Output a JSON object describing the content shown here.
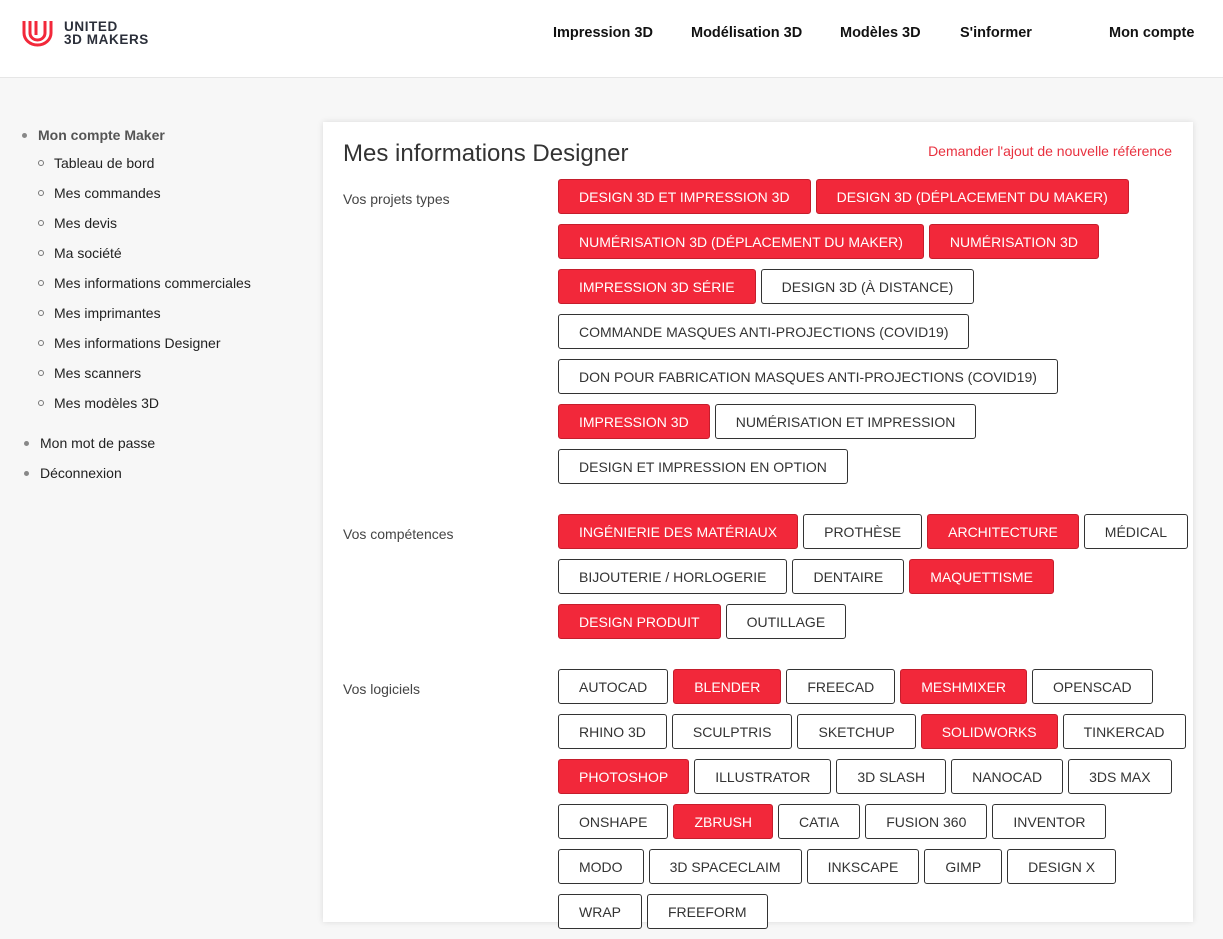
{
  "header": {
    "logo_line1": "UNITED",
    "logo_line2": "3D MAKERS",
    "nav": [
      {
        "label": "Impression 3D"
      },
      {
        "label": "Modélisation 3D"
      },
      {
        "label": "Modèles 3D"
      },
      {
        "label": "S'informer"
      },
      {
        "label": "Mon compte"
      }
    ]
  },
  "sidebar": {
    "heading": "Mon compte Maker",
    "subitems": [
      "Tableau de bord",
      "Mes commandes",
      "Mes devis",
      "Ma société",
      "Mes informations commerciales",
      "Mes imprimantes",
      "Mes informations Designer",
      "Mes scanners",
      "Mes modèles 3D"
    ],
    "items": [
      "Mon mot de passe",
      "Déconnexion"
    ]
  },
  "main": {
    "title": "Mes informations Designer",
    "request_link": "Demander l'ajout de nouvelle référence",
    "sections": [
      {
        "label": "Vos projets types",
        "rows": [
          [
            {
              "label": "DESIGN 3D ET IMPRESSION 3D",
              "selected": true
            },
            {
              "label": "DESIGN 3D (DÉPLACEMENT DU MAKER)",
              "selected": true
            }
          ],
          [
            {
              "label": "NUMÉRISATION 3D (DÉPLACEMENT DU MAKER)",
              "selected": true
            },
            {
              "label": "NUMÉRISATION 3D",
              "selected": true
            }
          ],
          [
            {
              "label": "IMPRESSION 3D SÉRIE",
              "selected": true
            },
            {
              "label": "DESIGN 3D (À DISTANCE)",
              "selected": false
            }
          ],
          [
            {
              "label": "COMMANDE MASQUES ANTI-PROJECTIONS (COVID19)",
              "selected": false
            }
          ],
          [
            {
              "label": "DON POUR FABRICATION MASQUES ANTI-PROJECTIONS (COVID19)",
              "selected": false
            }
          ],
          [
            {
              "label": "IMPRESSION 3D",
              "selected": true
            },
            {
              "label": "NUMÉRISATION ET IMPRESSION",
              "selected": false
            }
          ],
          [
            {
              "label": "DESIGN ET IMPRESSION EN OPTION",
              "selected": false
            }
          ]
        ]
      },
      {
        "label": "Vos compétences",
        "rows": [
          [
            {
              "label": "INGÉNIERIE DES MATÉRIAUX",
              "selected": true
            },
            {
              "label": "PROTHÈSE",
              "selected": false
            },
            {
              "label": "ARCHITECTURE",
              "selected": true
            },
            {
              "label": "MÉDICAL",
              "selected": false
            }
          ],
          [
            {
              "label": "BIJOUTERIE / HORLOGERIE",
              "selected": false
            },
            {
              "label": "DENTAIRE",
              "selected": false
            },
            {
              "label": "MAQUETTISME",
              "selected": true
            }
          ],
          [
            {
              "label": "DESIGN PRODUIT",
              "selected": true
            },
            {
              "label": "OUTILLAGE",
              "selected": false
            }
          ]
        ]
      },
      {
        "label": "Vos logiciels",
        "rows": [
          [
            {
              "label": "AUTOCAD",
              "selected": false
            },
            {
              "label": "BLENDER",
              "selected": true
            },
            {
              "label": "FREECAD",
              "selected": false
            },
            {
              "label": "MESHMIXER",
              "selected": true
            },
            {
              "label": "OPENSCAD",
              "selected": false
            }
          ],
          [
            {
              "label": "RHINO 3D",
              "selected": false
            },
            {
              "label": "SCULPTRIS",
              "selected": false
            },
            {
              "label": "SKETCHUP",
              "selected": false
            },
            {
              "label": "SOLIDWORKS",
              "selected": true
            },
            {
              "label": "TINKERCAD",
              "selected": false
            }
          ],
          [
            {
              "label": "PHOTOSHOP",
              "selected": true
            },
            {
              "label": "ILLUSTRATOR",
              "selected": false
            },
            {
              "label": "3D SLASH",
              "selected": false
            },
            {
              "label": "NANOCAD",
              "selected": false
            },
            {
              "label": "3DS MAX",
              "selected": false
            }
          ],
          [
            {
              "label": "ONSHAPE",
              "selected": false
            },
            {
              "label": "ZBRUSH",
              "selected": true
            },
            {
              "label": "CATIA",
              "selected": false
            },
            {
              "label": "FUSION 360",
              "selected": false
            },
            {
              "label": "INVENTOR",
              "selected": false
            }
          ],
          [
            {
              "label": "MODO",
              "selected": false
            },
            {
              "label": "3D SPACECLAIM",
              "selected": false
            },
            {
              "label": "INKSCAPE",
              "selected": false
            },
            {
              "label": "GIMP",
              "selected": false
            },
            {
              "label": "DESIGN X",
              "selected": false
            }
          ],
          [
            {
              "label": "WRAP",
              "selected": false
            },
            {
              "label": "FREEFORM",
              "selected": false
            }
          ]
        ]
      }
    ]
  }
}
